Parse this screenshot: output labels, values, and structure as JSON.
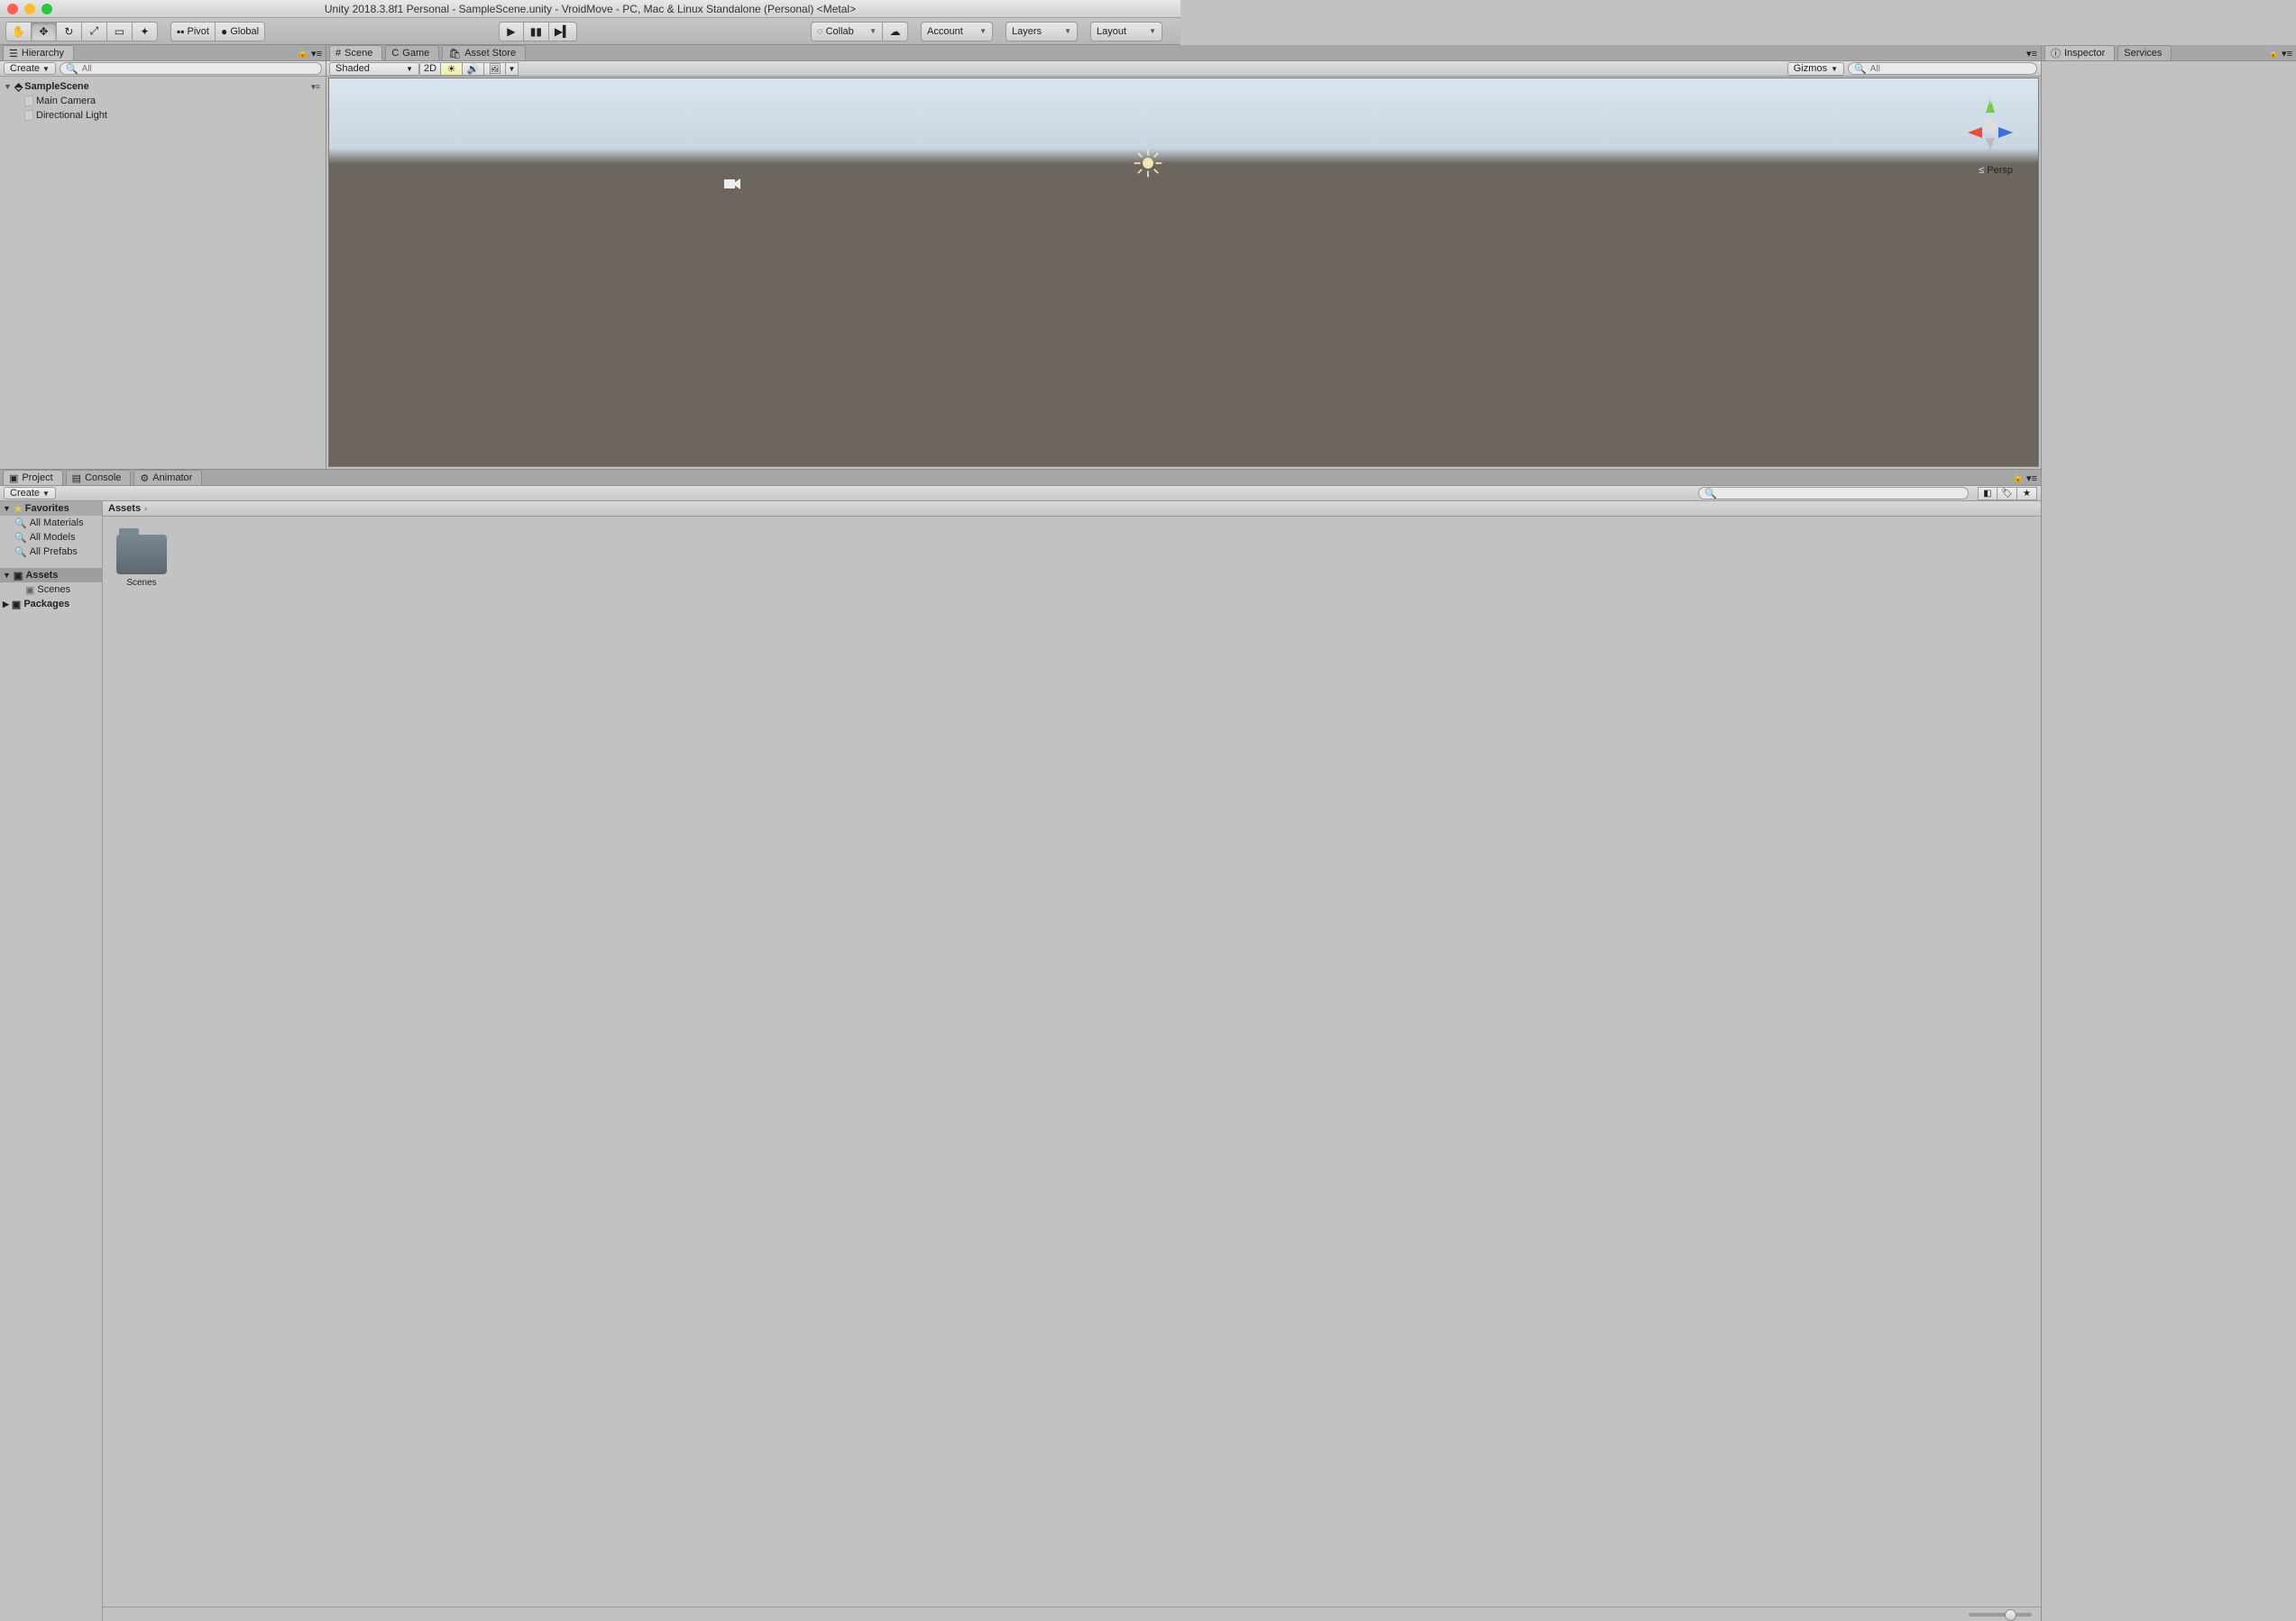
{
  "title": "Unity 2018.3.8f1 Personal - SampleScene.unity - VroidMove - PC, Mac & Linux Standalone (Personal) <Metal>",
  "toolbar": {
    "pivot": "Pivot",
    "global": "Global",
    "collab": "Collab",
    "account": "Account",
    "layers": "Layers",
    "layout": "Layout"
  },
  "hierarchy": {
    "tab": "Hierarchy",
    "create": "Create",
    "search_ph": "All",
    "scene": "SampleScene",
    "items": [
      "Main Camera",
      "Directional Light"
    ]
  },
  "scene": {
    "tabs": [
      "Scene",
      "Game",
      "Asset Store"
    ],
    "shading": "Shaded",
    "mode2d": "2D",
    "gizmos": "Gizmos",
    "search_ph": "All",
    "axis": {
      "x": "x",
      "y": "y",
      "z": "z"
    },
    "persp": "Persp"
  },
  "inspector": {
    "tabs": [
      "Inspector",
      "Services"
    ]
  },
  "project": {
    "tabs": [
      "Project",
      "Console",
      "Animator"
    ],
    "create": "Create",
    "search_ph": "",
    "favorites": {
      "label": "Favorites",
      "items": [
        "All Materials",
        "All Models",
        "All Prefabs"
      ]
    },
    "assets": {
      "label": "Assets",
      "children": [
        "Scenes"
      ]
    },
    "packages": "Packages",
    "crumb": "Assets",
    "grid": [
      {
        "name": "Scenes",
        "type": "folder"
      }
    ]
  }
}
